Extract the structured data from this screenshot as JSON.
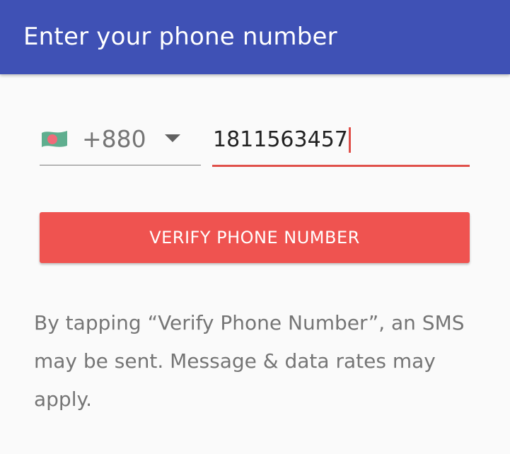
{
  "header": {
    "title": "Enter your phone number",
    "background_color": "#3f51b5"
  },
  "country_picker": {
    "flag_icon": "bangladesh-flag-icon",
    "dial_code": "+880",
    "dropdown_icon": "arrow-drop-down-icon"
  },
  "phone_input": {
    "value": "1811563457",
    "accent_color": "#e0504a"
  },
  "verify_button": {
    "label": "VERIFY PHONE NUMBER",
    "color": "#ef5350"
  },
  "disclaimer": {
    "text": "By tapping “Verify Phone Number”, an SMS may be sent. Message & data rates may apply."
  }
}
